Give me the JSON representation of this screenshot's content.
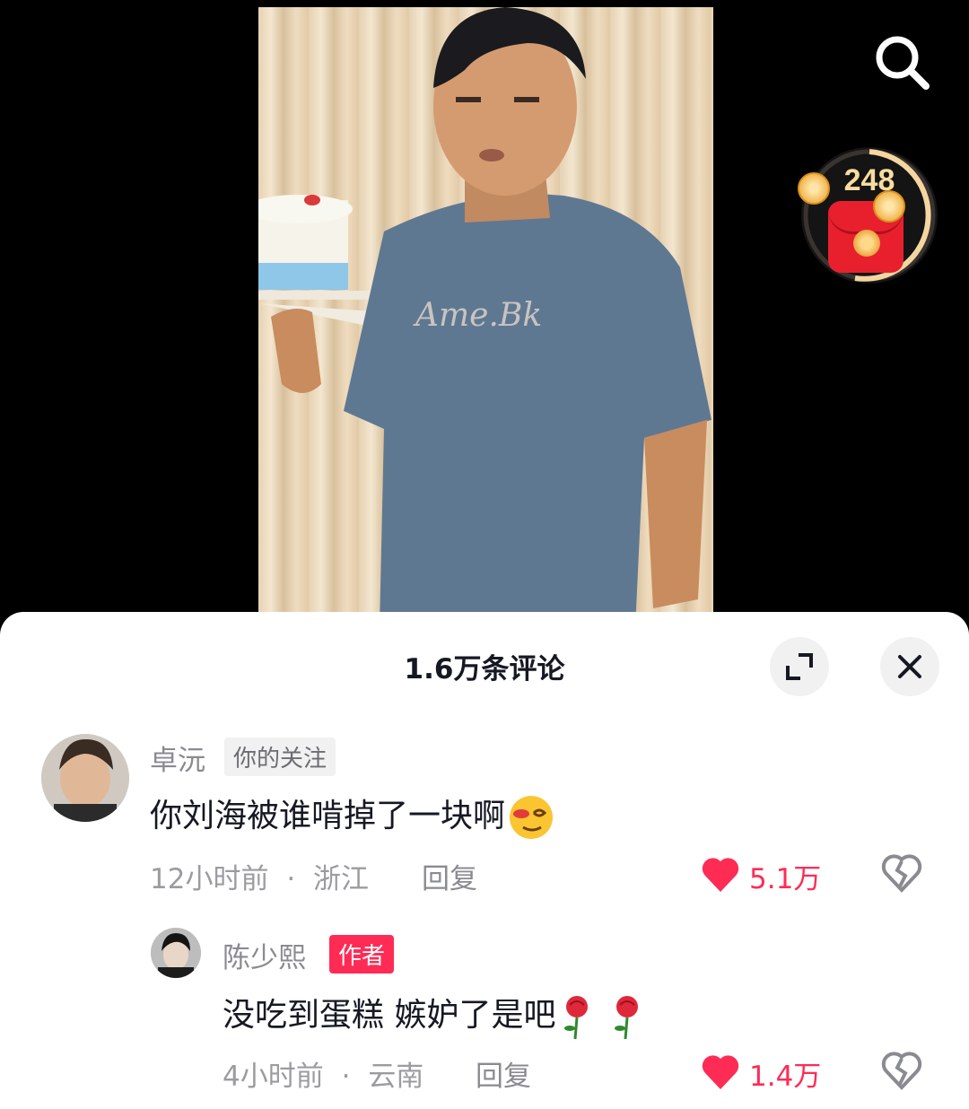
{
  "video": {
    "coin_count": "248"
  },
  "comments_panel": {
    "title": "1.6万条评论",
    "comments": [
      {
        "username": "卓沅",
        "tag": "你的关注",
        "text": "你刘海被谁啃掉了一块啊",
        "emoji": "dizzy-face-emoji",
        "time": "12小时前",
        "location": "浙江",
        "separator": "·",
        "reply_label": "回复",
        "likes": "5.1万"
      },
      {
        "username": "陈少熙",
        "tag": "作者",
        "text": "没吃到蛋糕 嫉妒了是吧",
        "emoji": "rose-emoji",
        "time": "4小时前",
        "location": "云南",
        "separator": "·",
        "reply_label": "回复",
        "likes": "1.4万"
      }
    ]
  },
  "colors": {
    "accent": "#fe2c55",
    "text_primary": "#161823",
    "text_secondary": "#8a8b91",
    "coin_gold": "#f7dca0"
  }
}
